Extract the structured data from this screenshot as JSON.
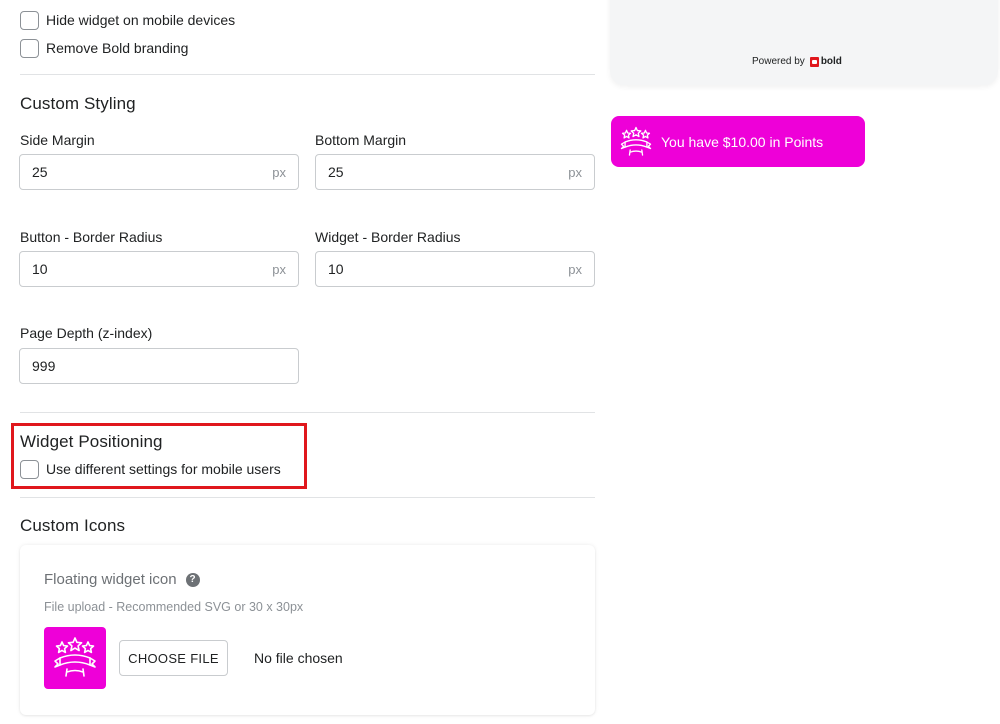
{
  "display_settings": {
    "hide_mobile_label": "Hide widget on mobile devices",
    "remove_branding_label": "Remove Bold branding"
  },
  "custom_styling": {
    "title": "Custom Styling",
    "side_margin": {
      "label": "Side Margin",
      "value": "25",
      "suffix": "px"
    },
    "bottom_margin": {
      "label": "Bottom Margin",
      "value": "25",
      "suffix": "px"
    },
    "button_radius": {
      "label": "Button - Border Radius",
      "value": "10",
      "suffix": "px"
    },
    "widget_radius": {
      "label": "Widget - Border Radius",
      "value": "10",
      "suffix": "px"
    },
    "page_depth": {
      "label": "Page Depth (z-index)",
      "value": "999"
    }
  },
  "widget_positioning": {
    "title": "Widget Positioning",
    "mobile_settings_label": "Use different settings for mobile users"
  },
  "custom_icons": {
    "title": "Custom Icons",
    "floating_icon": {
      "title": "Floating widget icon",
      "help_glyph": "?",
      "help_text": "File upload - Recommended SVG or 30 x 30px",
      "button_label": "CHOOSE FILE",
      "file_status": "No file chosen",
      "preview_icon": "stars-banner-icon"
    }
  },
  "preview": {
    "powered_by": "Powered by",
    "brand_name": "bold",
    "points_text": "You have $10.00 in Points",
    "points_icon": "stars-banner-icon"
  },
  "colors": {
    "accent": "#ee00d8",
    "highlight": "#e0171c",
    "brand_red": "#e0171c"
  }
}
